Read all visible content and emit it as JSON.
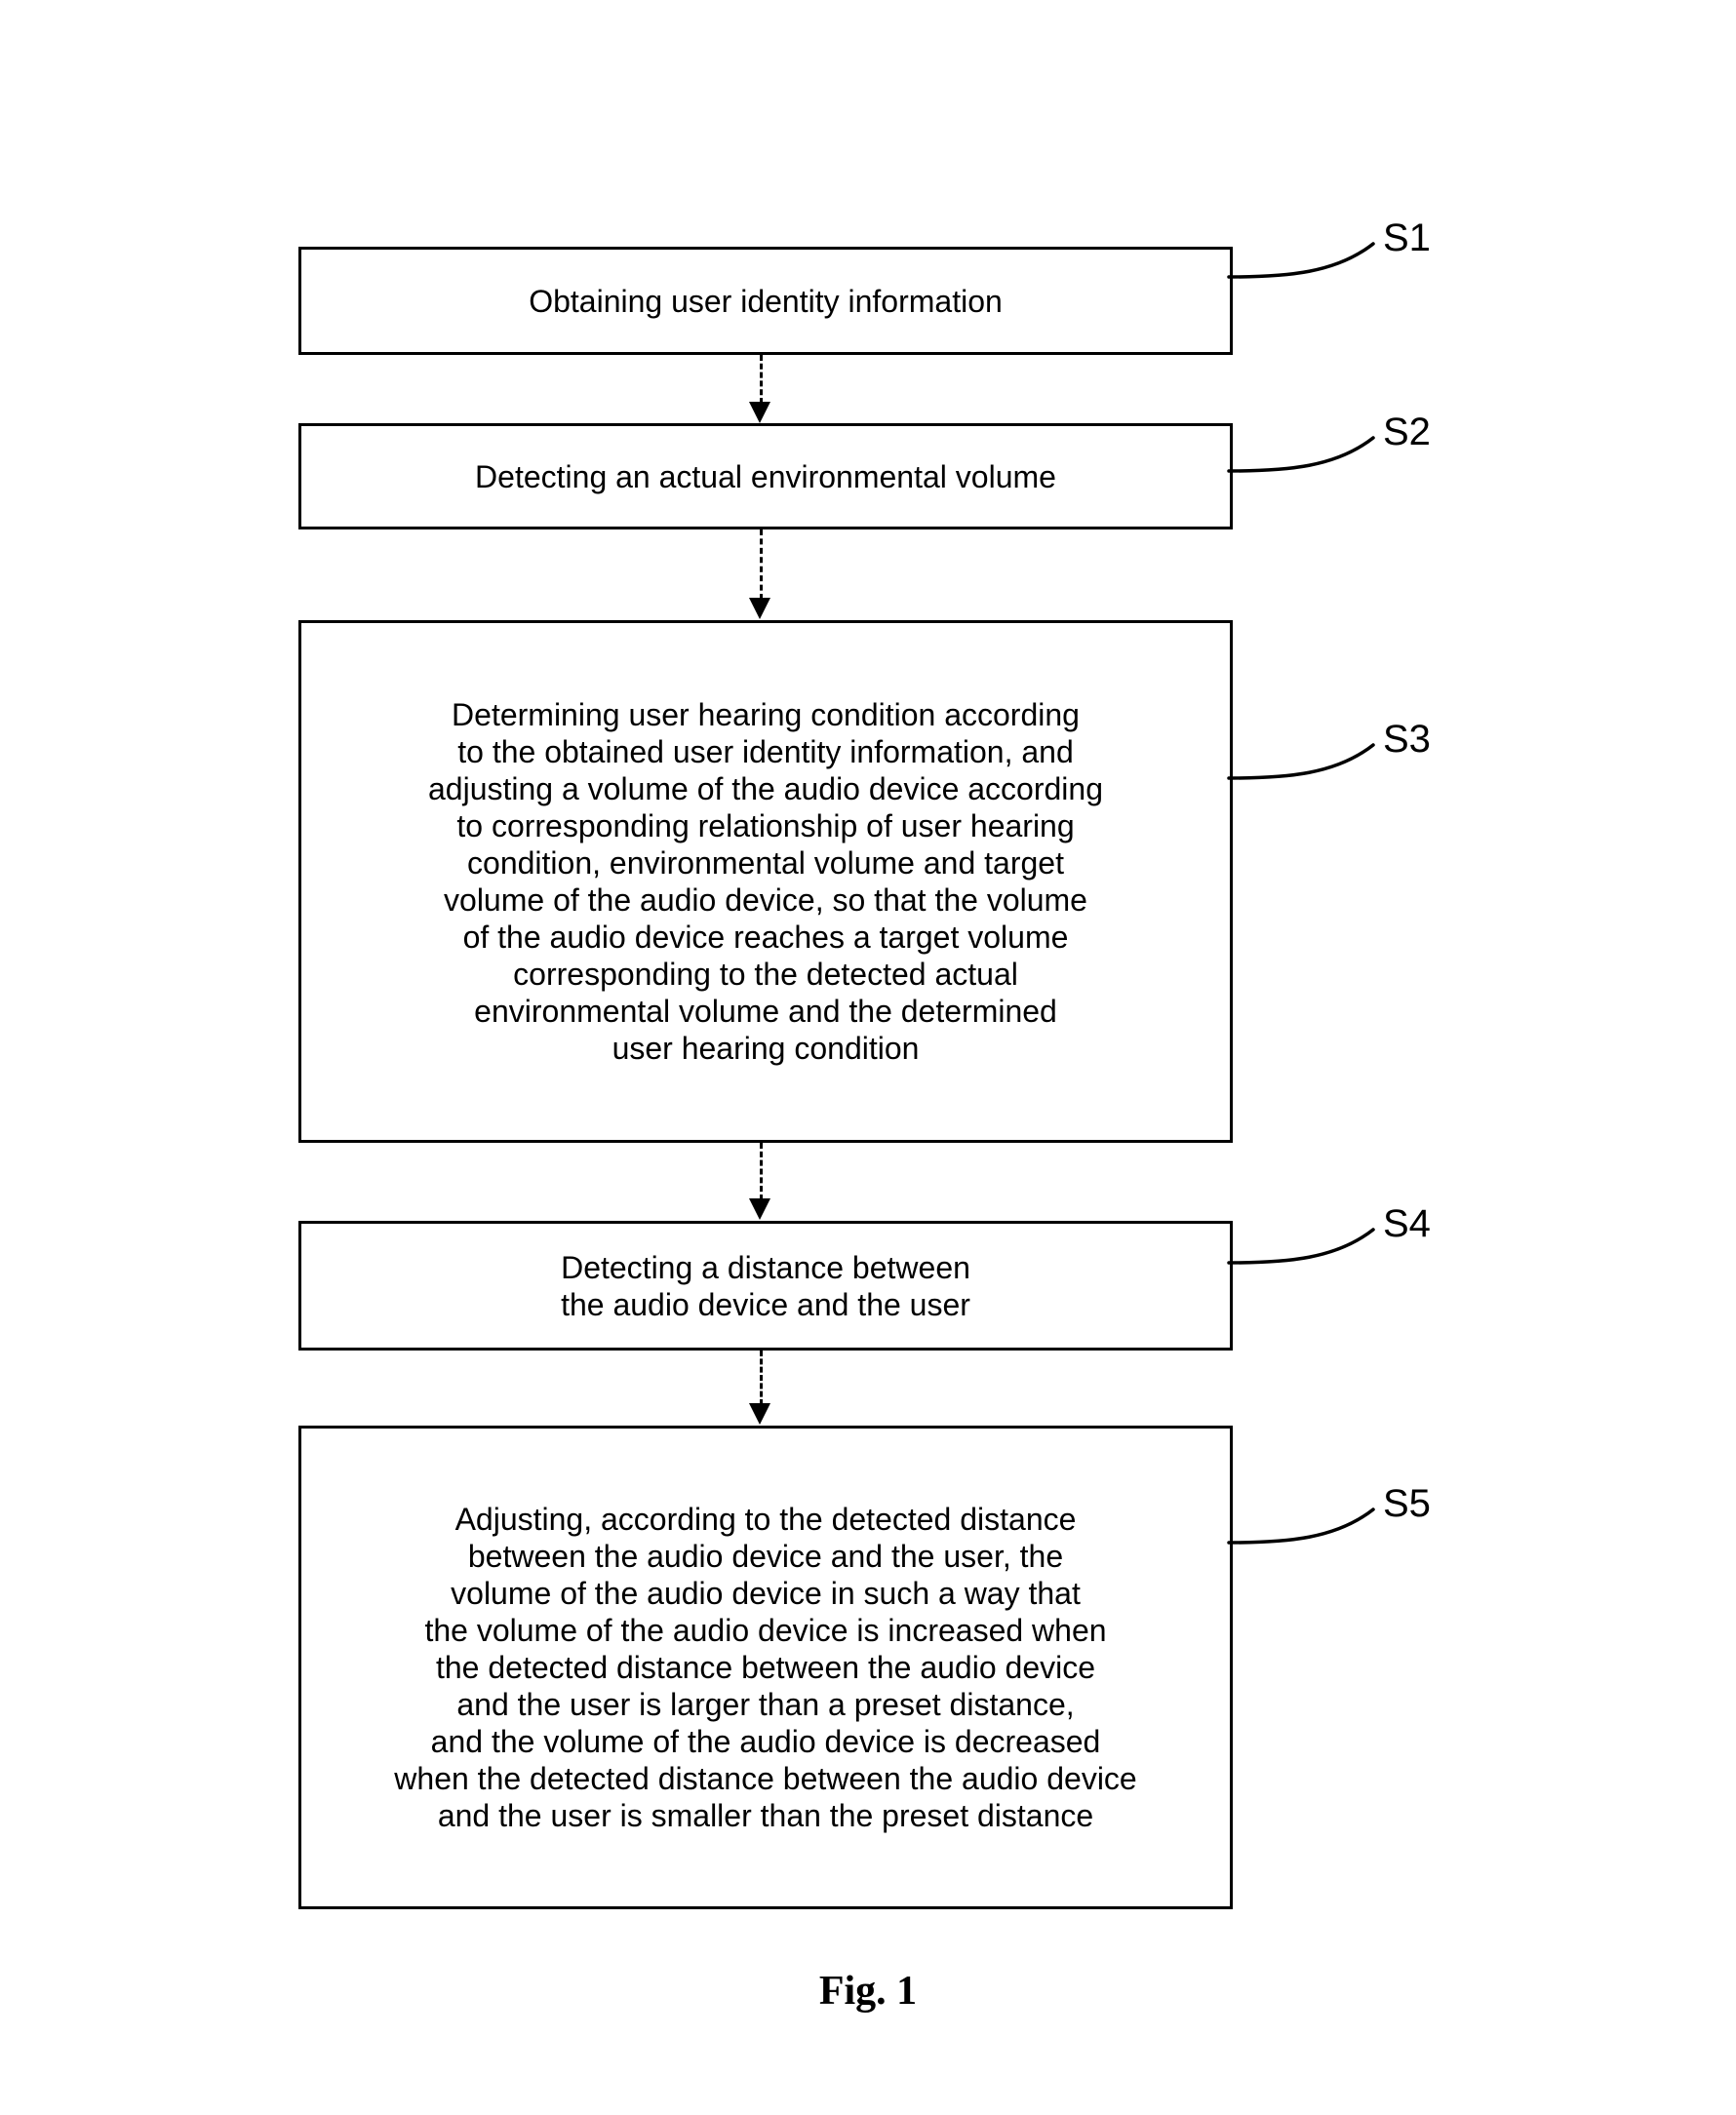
{
  "figure": {
    "caption": "Fig. 1",
    "type": "patent-flowchart",
    "orientation": "vertical",
    "background_color": "#ffffff",
    "line_color": "#000000"
  },
  "flowchart": {
    "steps": [
      {
        "id": "S1",
        "label": "S1",
        "text": "Obtaining user identity information"
      },
      {
        "id": "S2",
        "label": "S2",
        "text": "Detecting an actual environmental volume"
      },
      {
        "id": "S3",
        "label": "S3",
        "text": "Determining user hearing condition according\nto the obtained user identity information, and\nadjusting a volume of the audio device according\nto corresponding relationship of user hearing\ncondition, environmental volume and target\nvolume of the audio device, so that the volume\nof the audio device reaches a target volume\ncorresponding to the detected actual\nenvironmental volume and the determined\nuser hearing condition"
      },
      {
        "id": "S4",
        "label": "S4",
        "text": "Detecting a distance between\nthe audio device and the user"
      },
      {
        "id": "S5",
        "label": "S5",
        "text": "Adjusting, according to the detected distance\nbetween the audio device and the user, the\nvolume of the audio device in such a way that\nthe volume of the audio device is increased when\nthe detected distance between the audio device\nand the user is larger than a preset distance,\nand the volume of the audio device is decreased\nwhen the detected distance between the audio device\nand the user is smaller than the preset distance"
      }
    ],
    "connectors": [
      {
        "from": "S1",
        "to": "S2",
        "style": "dashed-arrow-down"
      },
      {
        "from": "S2",
        "to": "S3",
        "style": "dashed-arrow-down"
      },
      {
        "from": "S3",
        "to": "S4",
        "style": "dashed-arrow-down"
      },
      {
        "from": "S4",
        "to": "S5",
        "style": "dashed-arrow-down"
      }
    ]
  }
}
